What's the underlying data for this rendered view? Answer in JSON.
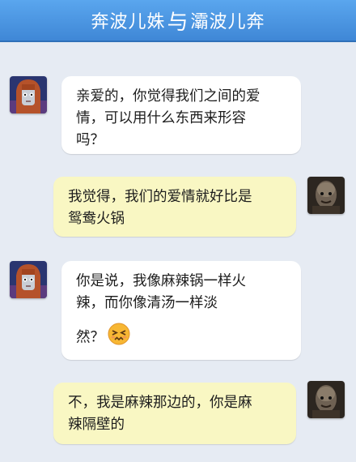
{
  "header": {
    "title_left": "奔波儿姝",
    "title_sep": "与",
    "title_right": "灞波儿奔"
  },
  "messages": [
    {
      "sender": "girl",
      "lines": [
        "亲爱的，你觉得我们之间的爱",
        "情，可以用什么东西来形容",
        "吗？"
      ]
    },
    {
      "sender": "man",
      "lines": [
        "我觉得，我们的爱情就好比是",
        "鸳鸯火锅"
      ]
    },
    {
      "sender": "girl",
      "lines": [
        "你是说，我像麻辣锅一样火",
        "辣，而你像清汤一样淡",
        "然？"
      ],
      "emoji": "confounded-face-icon"
    },
    {
      "sender": "man",
      "lines": [
        "不，我是麻辣那边的，你是麻",
        "辣隔壁的"
      ]
    }
  ],
  "colors": {
    "background": "#e6ebf3",
    "titlebar": "#4a96e3",
    "bubble_left": "#ffffff",
    "bubble_right": "#f9f7c3"
  }
}
